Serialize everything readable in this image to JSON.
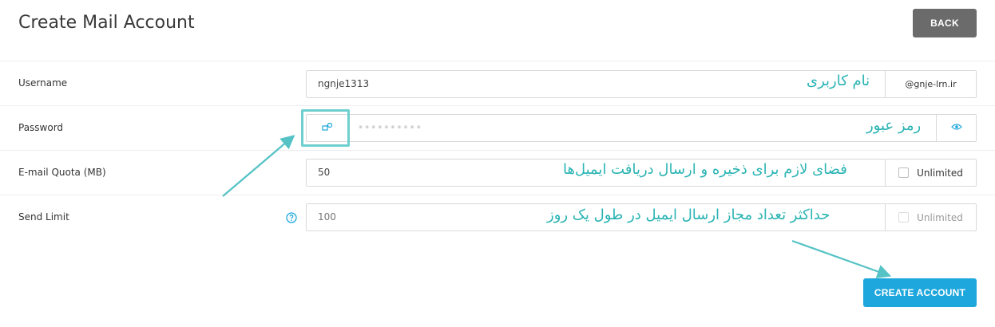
{
  "header": {
    "title": "Create Mail Account",
    "back_label": "BACK"
  },
  "form": {
    "username": {
      "label": "Username",
      "value": "ngnje1313",
      "domain_suffix": "@gnje-lrn.ir"
    },
    "password": {
      "label": "Password",
      "value": "••••••••••",
      "generate_icon": "key-generate-icon",
      "toggle_icon": "eye-icon"
    },
    "quota": {
      "label": "E-mail Quota (MB)",
      "value": "50",
      "unlimited_label": "Unlimited",
      "unlimited_checked": false
    },
    "send_limit": {
      "label": "Send Limit",
      "value": "100",
      "unlimited_label": "Unlimited",
      "unlimited_checked": false,
      "help_icon": "question-circle-icon"
    }
  },
  "annotations": {
    "username": "نام کاربری",
    "password": "رمز عبور",
    "quota": "فضای لازم برای ذخیره و ارسال دریافت ایمیل‌ها",
    "send_limit": "حداکثر تعداد مجاز ارسال ایمیل در طول یک روز"
  },
  "footer": {
    "create_label": "CREATE ACCOUNT"
  },
  "colors": {
    "accent": "#1ea7dc",
    "annotation": "#2ab3b3",
    "back_button": "#6b6b6b"
  }
}
